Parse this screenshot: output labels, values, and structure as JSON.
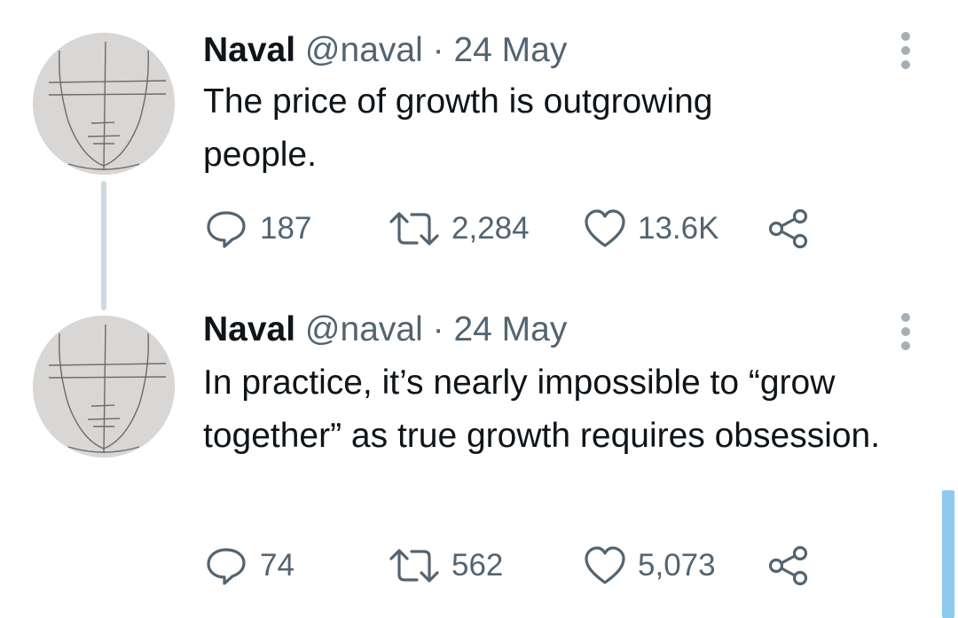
{
  "tweets": [
    {
      "name": "Naval",
      "handle": "@naval",
      "separator": "·",
      "date": "24 May",
      "text": "The price of growth is outgrowing people.",
      "replies": "187",
      "retweets": "2,284",
      "likes": "13.6K"
    },
    {
      "name": "Naval",
      "handle": "@naval",
      "separator": "·",
      "date": "24 May",
      "text": "In practice, it’s nearly impossible to “grow together” as true growth requires obsession.",
      "replies": "74",
      "retweets": "562",
      "likes": "5,073"
    }
  ],
  "icons": {
    "reply": "reply-icon",
    "retweet": "retweet-icon",
    "like": "heart-icon",
    "share": "share-icon",
    "more": "more-options-icon"
  },
  "colors": {
    "text": "#0f1419",
    "secondary": "#536471",
    "thread_line": "#cfd9de",
    "scrollbar": "#8ccaf0"
  }
}
